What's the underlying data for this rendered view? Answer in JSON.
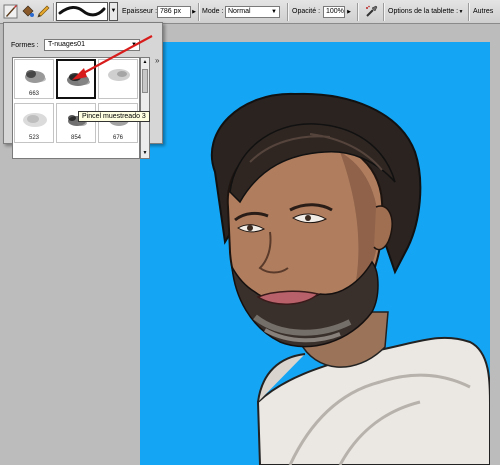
{
  "options_bar": {
    "tool_icons": [
      "brush-tool-icon",
      "paint-bucket-icon",
      "pencil-icon"
    ],
    "thickness_label": "Epaisseur :",
    "thickness_value": "786 px",
    "mode_label": "Mode :",
    "mode_value": "Normal",
    "opacity_label": "Opacité :",
    "opacity_value": "100%",
    "airbrush_icon": "airbrush-icon",
    "tablet_options_label": "Options de la tablette :",
    "other_label": "Autres"
  },
  "brush_picker": {
    "shapes_label": "Formes :",
    "shapes_value": "T-nuages01",
    "flyout_icon": "flyout-menu-icon",
    "brushes": [
      {
        "number": "663",
        "selected": false
      },
      {
        "number": "",
        "selected": true
      },
      {
        "number": "",
        "selected": false
      },
      {
        "number": "523",
        "selected": false
      },
      {
        "number": "854",
        "selected": false
      },
      {
        "number": "676",
        "selected": false
      }
    ],
    "tooltip": "Pincel muestreado 3"
  },
  "canvas": {
    "background_color": "#14a6f4",
    "subject": "illustrated portrait"
  },
  "colors": {
    "annotation_arrow": "#d81c1c"
  }
}
